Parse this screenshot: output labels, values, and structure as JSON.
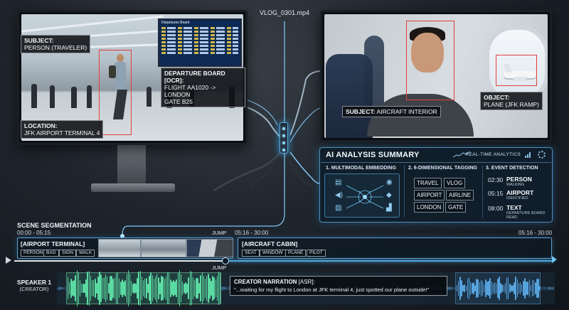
{
  "file_name": "VLOG_0301.mp4",
  "left_screen": {
    "subject_label": "SUBJECT:",
    "subject_value": "PERSON (TRAVELER)",
    "location_label": "LOCATION:",
    "location_value": "JFK AIRPORT TERMINAL 4",
    "board_label": "DEPARTURE BOARD [OCR]:",
    "board_value_1": "FLIGHT AA1020 -> LONDON",
    "board_value_2": "GATE B25",
    "board_sign": "Departures Board"
  },
  "right_screen": {
    "subject_label": "SUBJECT:",
    "subject_value": "AIRCRAFT INTERIOR",
    "object_label": "OBJECT:",
    "object_value": "PLANE (JFK RAMP)"
  },
  "panel": {
    "title": "AI ANALYSIS SUMMARY",
    "realtime": "REAL-TIME ANALYTICS",
    "col1_title": "1. MULTIMODAL EMBEDDING",
    "col2_title": "2. 6-DIMENSIONAL TAGGING",
    "col3_title": "3. EVENT DETECTION",
    "tags": [
      "TRAVEL",
      "VLOG",
      "AIRPORT",
      "AIRLINE",
      "LONDON",
      "GATE"
    ],
    "events": [
      {
        "time": "02:30",
        "name": "PERSON",
        "sub": "WALKING"
      },
      {
        "time": "05:15",
        "name": "AIRPORT",
        "sub": "IDENTIFIED"
      },
      {
        "time": "08:00",
        "name": "TEXT",
        "sub": "DEPARTURE BOARD READ"
      }
    ]
  },
  "timeline": {
    "title": "SCENE SEGMENTATION",
    "seg1_time": "00:00 - 05:15",
    "seg2_time": "05:16 - 30:00",
    "seg2_time_end": "05:16 - 30:00",
    "jump_top": "JUMP",
    "jump_bottom": "JUMP",
    "seg1_title": "[AIRPORT TERMINAL]",
    "seg1_tags": [
      "PERSON",
      "BAG",
      "SIGN",
      "WALK"
    ],
    "seg2_title": "[AIRCRAFT CABIN]",
    "seg2_tags": [
      "SEAT",
      "WINDOW",
      "PLANE",
      "PILOT"
    ]
  },
  "audio": {
    "speaker": "SPEAKER 1",
    "speaker_sub": "(CREATOR)",
    "narration_title": "CREATOR NARRATION",
    "narration_tag": "[ASR]:",
    "narration_text": "\"...waiting for my flight to London at JFK terminal 4, just spotted our plane outside!\""
  },
  "colors": {
    "accent": "#4fa8e0",
    "box_red": "#e0413c",
    "wave_green": "#5fe3a8",
    "wave_blue": "#5aa9e6"
  }
}
